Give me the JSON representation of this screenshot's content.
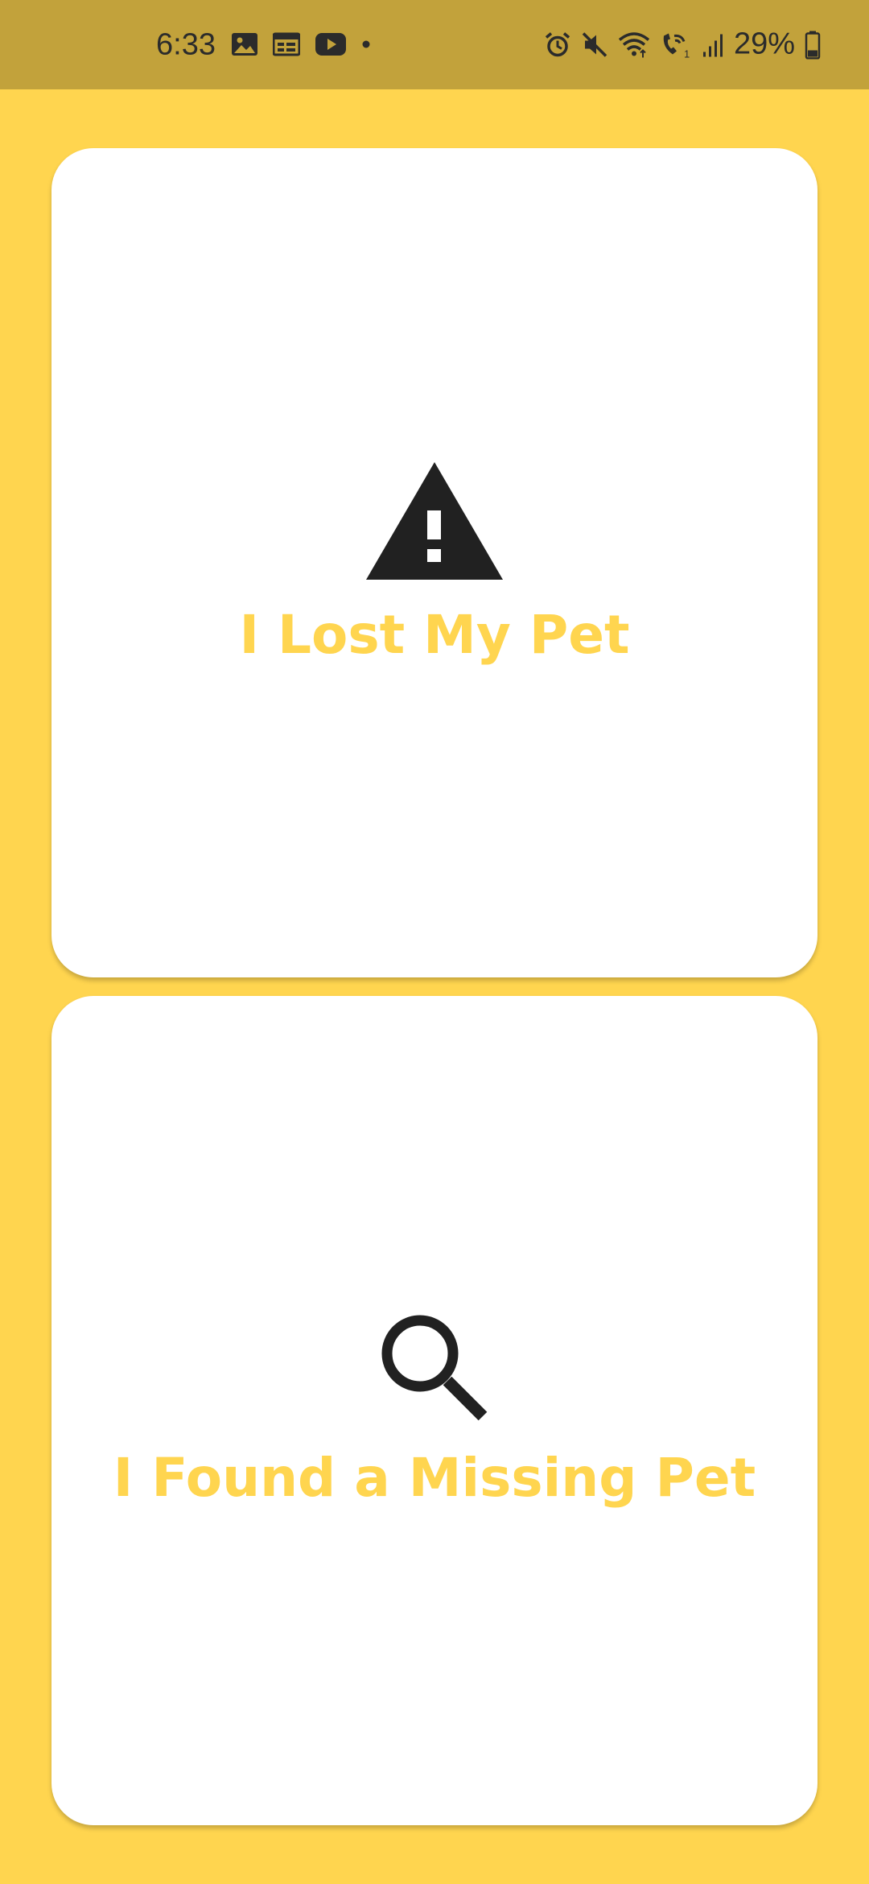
{
  "status_bar": {
    "time": "6:33",
    "battery_percent": "29%",
    "left_icons": [
      "gallery-icon",
      "calendar-icon",
      "youtube-icon",
      "notification-dot-icon"
    ],
    "right_icons": [
      "alarm-icon",
      "mute-icon",
      "wifi-icon",
      "wifi-calling-icon",
      "signal-icon",
      "battery-icon"
    ]
  },
  "cards": {
    "lost": {
      "label": "I Lost My Pet",
      "icon": "warning-icon"
    },
    "found": {
      "label": "I Found a Missing Pet",
      "icon": "search-icon"
    }
  },
  "colors": {
    "background": "#FFD54F",
    "status_bar": "#C2A23B",
    "card": "#FFFFFF",
    "label": "#FFD54F",
    "icon": "#212121"
  }
}
